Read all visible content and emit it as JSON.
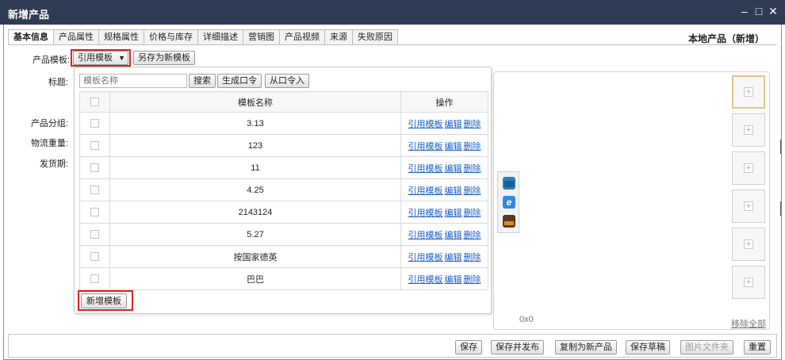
{
  "window": {
    "title": "新增产品",
    "minimize": "–",
    "maximize": "□",
    "close": "✕"
  },
  "tabs": [
    "基本信息",
    "产品属性",
    "规格属性",
    "价格与库存",
    "详细描述",
    "营销图",
    "产品视频",
    "来源",
    "失败原因"
  ],
  "header_right": "本地产品（新增）",
  "form": {
    "template_label": "产品模板:",
    "use_template_btn": "引用模板",
    "save_as_template_btn": "另存为新模板",
    "title_label": "标题:",
    "group_label": "产品分组:",
    "weight_label": "物流重量:",
    "ship_label": "发货期:"
  },
  "popup": {
    "search_placeholder": "模板名称",
    "search_btn": "搜索",
    "gen_code_btn": "生成口令",
    "from_code_btn": "从口令入",
    "col_name": "模板名称",
    "col_action": "操作",
    "action_use": "引用模板",
    "action_edit": "编辑",
    "action_delete": "删除",
    "rows": [
      {
        "name": "3.13"
      },
      {
        "name": "123"
      },
      {
        "name": "11"
      },
      {
        "name": "4.25"
      },
      {
        "name": "2143124"
      },
      {
        "name": "5.27"
      },
      {
        "name": "按国家德英"
      },
      {
        "name": "巴巴"
      }
    ],
    "new_template_btn": "新增模板"
  },
  "images": {
    "dimension": "0x0",
    "remove_all": "移除全部",
    "tool_icons": [
      "folder-icon",
      "ie-browser-icon",
      "photo-icon"
    ],
    "slots": 6
  },
  "bottom": {
    "save": "保存",
    "save_publish": "保存并发布",
    "copy_new": "复制为新产品",
    "save_draft": "保存草稿",
    "image_folder": "图片文件夹",
    "reset": "重置"
  },
  "colors": {
    "titlebar": "#2f3b52",
    "highlight": "#e02020",
    "link": "#1a5fc8"
  }
}
